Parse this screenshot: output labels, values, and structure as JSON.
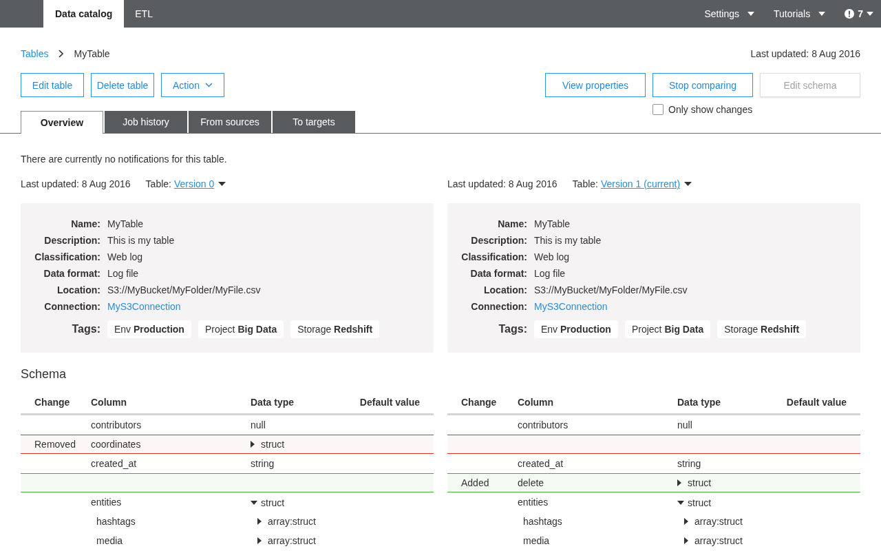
{
  "top_nav": {
    "tabs": [
      {
        "label": "Data catalog",
        "selected": true
      },
      {
        "label": "ETL",
        "selected": false
      }
    ],
    "menus": [
      {
        "label": "Settings"
      },
      {
        "label": "Tutorials"
      }
    ],
    "alerts": {
      "count": "7"
    }
  },
  "breadcrumb": {
    "items": [
      {
        "label": "Tables",
        "kind": "link"
      },
      {
        "label": "MyTable",
        "kind": "current"
      }
    ]
  },
  "last_updated": "Last updated: 8 Aug 2016",
  "toolbar": {
    "left_buttons": [
      {
        "label": "Edit table",
        "disabled": false,
        "has_menu": false
      },
      {
        "label": "Delete table",
        "disabled": false,
        "has_menu": false
      },
      {
        "label": "Action",
        "disabled": false,
        "has_menu": true
      }
    ],
    "right_buttons": [
      {
        "label": "View properties",
        "disabled": false
      },
      {
        "label": "Stop comparing",
        "disabled": false
      },
      {
        "label": "Edit schema",
        "disabled": true
      }
    ],
    "only_show_changes": {
      "label": "Only show changes",
      "checked": false
    }
  },
  "tabs": [
    {
      "label": "Overview",
      "selected": true
    },
    {
      "label": "Job history",
      "selected": false
    },
    {
      "label": "From sources",
      "selected": false
    },
    {
      "label": "To targets",
      "selected": false
    }
  ],
  "notification": "There are currently no notifications for this table.",
  "versions": [
    {
      "last_updated": "Last updated: 8 Aug 2016",
      "table_label": "Table:",
      "version": "Version 0",
      "properties": [
        {
          "label": "Name:",
          "value": "MyTable",
          "kind": "text"
        },
        {
          "label": "Description:",
          "value": "This is my table",
          "kind": "text"
        },
        {
          "label": "Classification:",
          "value": "Web log",
          "kind": "text"
        },
        {
          "label": "Data format:",
          "value": "Log file",
          "kind": "text"
        },
        {
          "label": "Location:",
          "value": "S3://MyBucket/MyFolder/MyFile.csv",
          "kind": "text"
        },
        {
          "label": "Connection:",
          "value": "MyS3Connection",
          "kind": "link"
        }
      ],
      "tags_label": "Tags:",
      "tags": [
        "Env **Production**",
        "Project **Big Data**",
        "Storage **Redshift**"
      ]
    },
    {
      "last_updated": "Last updated: 8 Aug 2016",
      "table_label": "Table:",
      "version": "Version 1 (current)",
      "properties": [
        {
          "label": "Name:",
          "value": "MyTable",
          "kind": "text"
        },
        {
          "label": "Description:",
          "value": "This is my table",
          "kind": "text"
        },
        {
          "label": "Classification:",
          "value": "Web log",
          "kind": "text"
        },
        {
          "label": "Data format:",
          "value": "Log file",
          "kind": "text"
        },
        {
          "label": "Location:",
          "value": "S3://MyBucket/MyFolder/MyFile.csv",
          "kind": "text"
        },
        {
          "label": "Connection:",
          "value": "MyS3Connection",
          "kind": "link"
        }
      ],
      "tags_label": "Tags:",
      "tags": [
        "Env **Production**",
        "Project **Big Data**",
        "Storage **Redshift**"
      ]
    }
  ],
  "schema": {
    "title": "Schema",
    "tables": [
      {
        "columns": [
          "Change",
          "Column",
          "Data type",
          "Default value"
        ],
        "rows": [
          {
            "removed": false,
            "added": false,
            "column": "contributors",
            "data_type": "null"
          },
          {
            "removed": true,
            "added": false,
            "change": "Removed",
            "column": "coordinates",
            "data_type": "struct",
            "expanded": false
          },
          {
            "removed": false,
            "added": false,
            "column": "created_at",
            "data_type": "string"
          },
          {
            "removed": false,
            "added": true
          },
          {
            "removed": false,
            "added": false,
            "column": "entities",
            "data_type": "struct",
            "expanded": true,
            "children": [
              {
                "removed": false,
                "added": false,
                "column": "hashtags",
                "data_type": "array:struct",
                "expanded": false
              },
              {
                "removed": false,
                "added": false,
                "column": "media",
                "data_type": "array:struct",
                "expanded": false
              }
            ]
          }
        ]
      },
      {
        "columns": [
          "Change",
          "Column",
          "Data type",
          "Default value"
        ],
        "rows": [
          {
            "removed": false,
            "added": false,
            "column": "contributors",
            "data_type": "null"
          },
          {
            "removed": true,
            "added": false
          },
          {
            "removed": false,
            "added": false,
            "column": "created_at",
            "data_type": "string"
          },
          {
            "removed": false,
            "added": true,
            "change": "Added",
            "column": "delete",
            "data_type": "struct",
            "expanded": false
          },
          {
            "removed": false,
            "added": false,
            "column": "entities",
            "data_type": "struct",
            "expanded": true,
            "children": [
              {
                "removed": false,
                "added": false,
                "column": "hashtags",
                "data_type": "array:struct",
                "expanded": false
              },
              {
                "removed": false,
                "added": false,
                "column": "media",
                "data_type": "array:struct",
                "expanded": false
              }
            ]
          }
        ]
      }
    ]
  }
}
